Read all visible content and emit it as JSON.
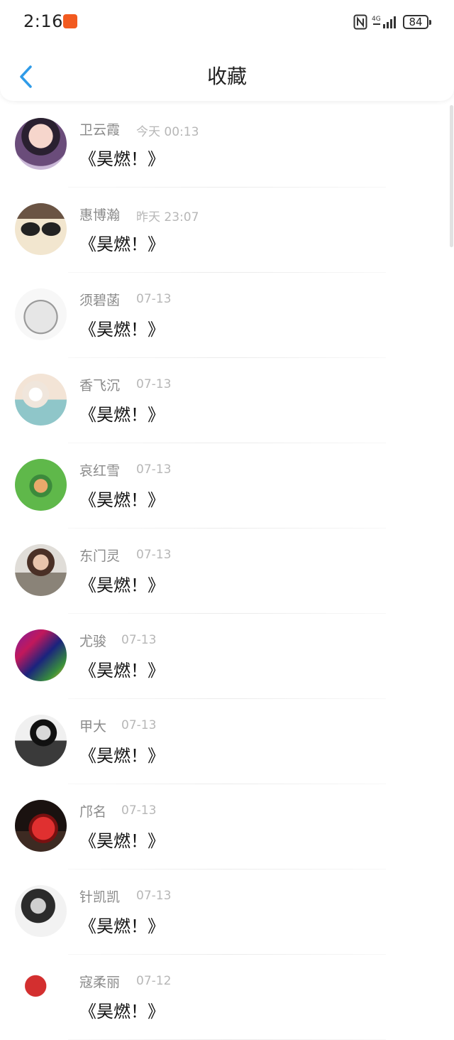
{
  "status_bar": {
    "time": "2:16",
    "network": "4G",
    "battery": "84"
  },
  "header": {
    "title": "收藏",
    "back_icon": "chevron-left-icon"
  },
  "items": [
    {
      "name": "卫云霞",
      "time": "今天 00:13",
      "content": "《昊燃！》"
    },
    {
      "name": "惠博瀚",
      "time": "昨天 23:07",
      "content": "《昊燃！》"
    },
    {
      "name": "须碧菡",
      "time": "07-13",
      "content": "《昊燃！》"
    },
    {
      "name": "香飞沉",
      "time": "07-13",
      "content": "《昊燃！》"
    },
    {
      "name": "哀红雪",
      "time": "07-13",
      "content": "《昊燃！》"
    },
    {
      "name": "东门灵",
      "time": "07-13",
      "content": "《昊燃！》"
    },
    {
      "name": "尤骏",
      "time": "07-13",
      "content": "《昊燃！》"
    },
    {
      "name": "甲大",
      "time": "07-13",
      "content": "《昊燃！》"
    },
    {
      "name": "邝名",
      "time": "07-13",
      "content": "《昊燃！》"
    },
    {
      "name": "针凯凯",
      "time": "07-13",
      "content": "《昊燃！》"
    },
    {
      "name": "寇柔丽",
      "time": "07-12",
      "content": "《昊燃！》"
    }
  ],
  "colors": {
    "accent": "#2f9be8",
    "name_text": "#8a8a8a",
    "time_text": "#b7b7b7",
    "content_text": "#111111"
  }
}
